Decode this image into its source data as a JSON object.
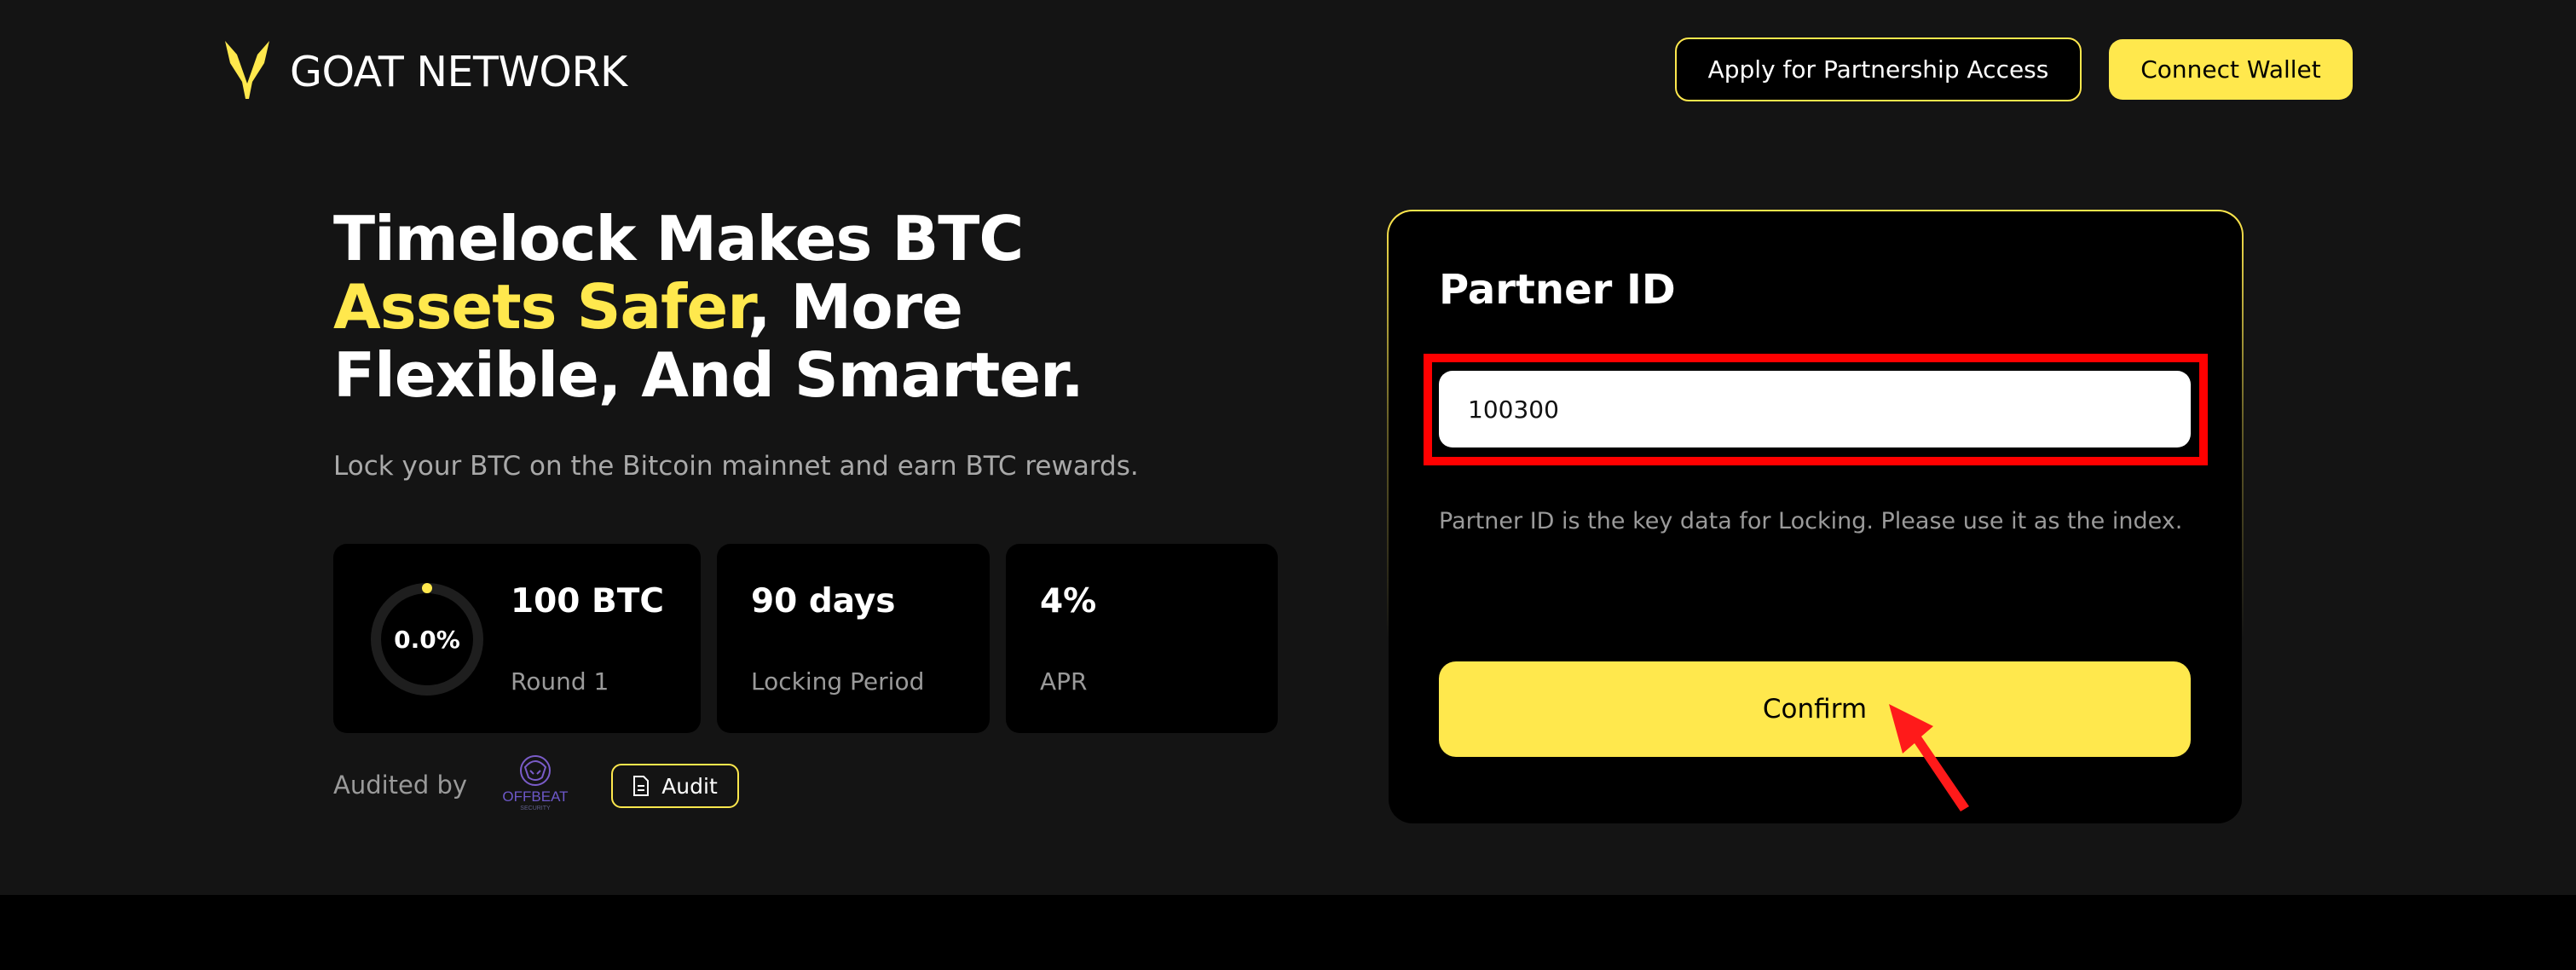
{
  "header": {
    "brand_name": "GOAT NETWORK",
    "partnership_button": "Apply for Partnership Access",
    "connect_wallet_button": "Connect Wallet"
  },
  "hero": {
    "headline_part1": "Timelock Makes BTC ",
    "headline_accent": "Assets Safer",
    "headline_part2": ", More Flexible, And Smarter.",
    "subtitle": "Lock your BTC on the Bitcoin mainnet and earn BTC rewards."
  },
  "stats": {
    "round": {
      "progress_text": "0.0%",
      "progress_fraction": 0.0,
      "value": "100 BTC",
      "label": "Round 1"
    },
    "period": {
      "value": "90 days",
      "label": "Locking Period"
    },
    "apr": {
      "value": "4%",
      "label": "APR"
    }
  },
  "audit": {
    "label": "Audited by",
    "auditor_logo_text": "OFFBEAT",
    "auditor_logo_subtext": "SECURITY",
    "button": "Audit"
  },
  "form": {
    "title": "Partner ID",
    "input_value": "100300",
    "hint": "Partner ID is the key data for Locking. Please use it as the index.",
    "confirm_button": "Confirm"
  },
  "colors": {
    "accent": "#ffe84d",
    "background": "#141414",
    "card": "#000000",
    "annotation": "#ff0000"
  }
}
